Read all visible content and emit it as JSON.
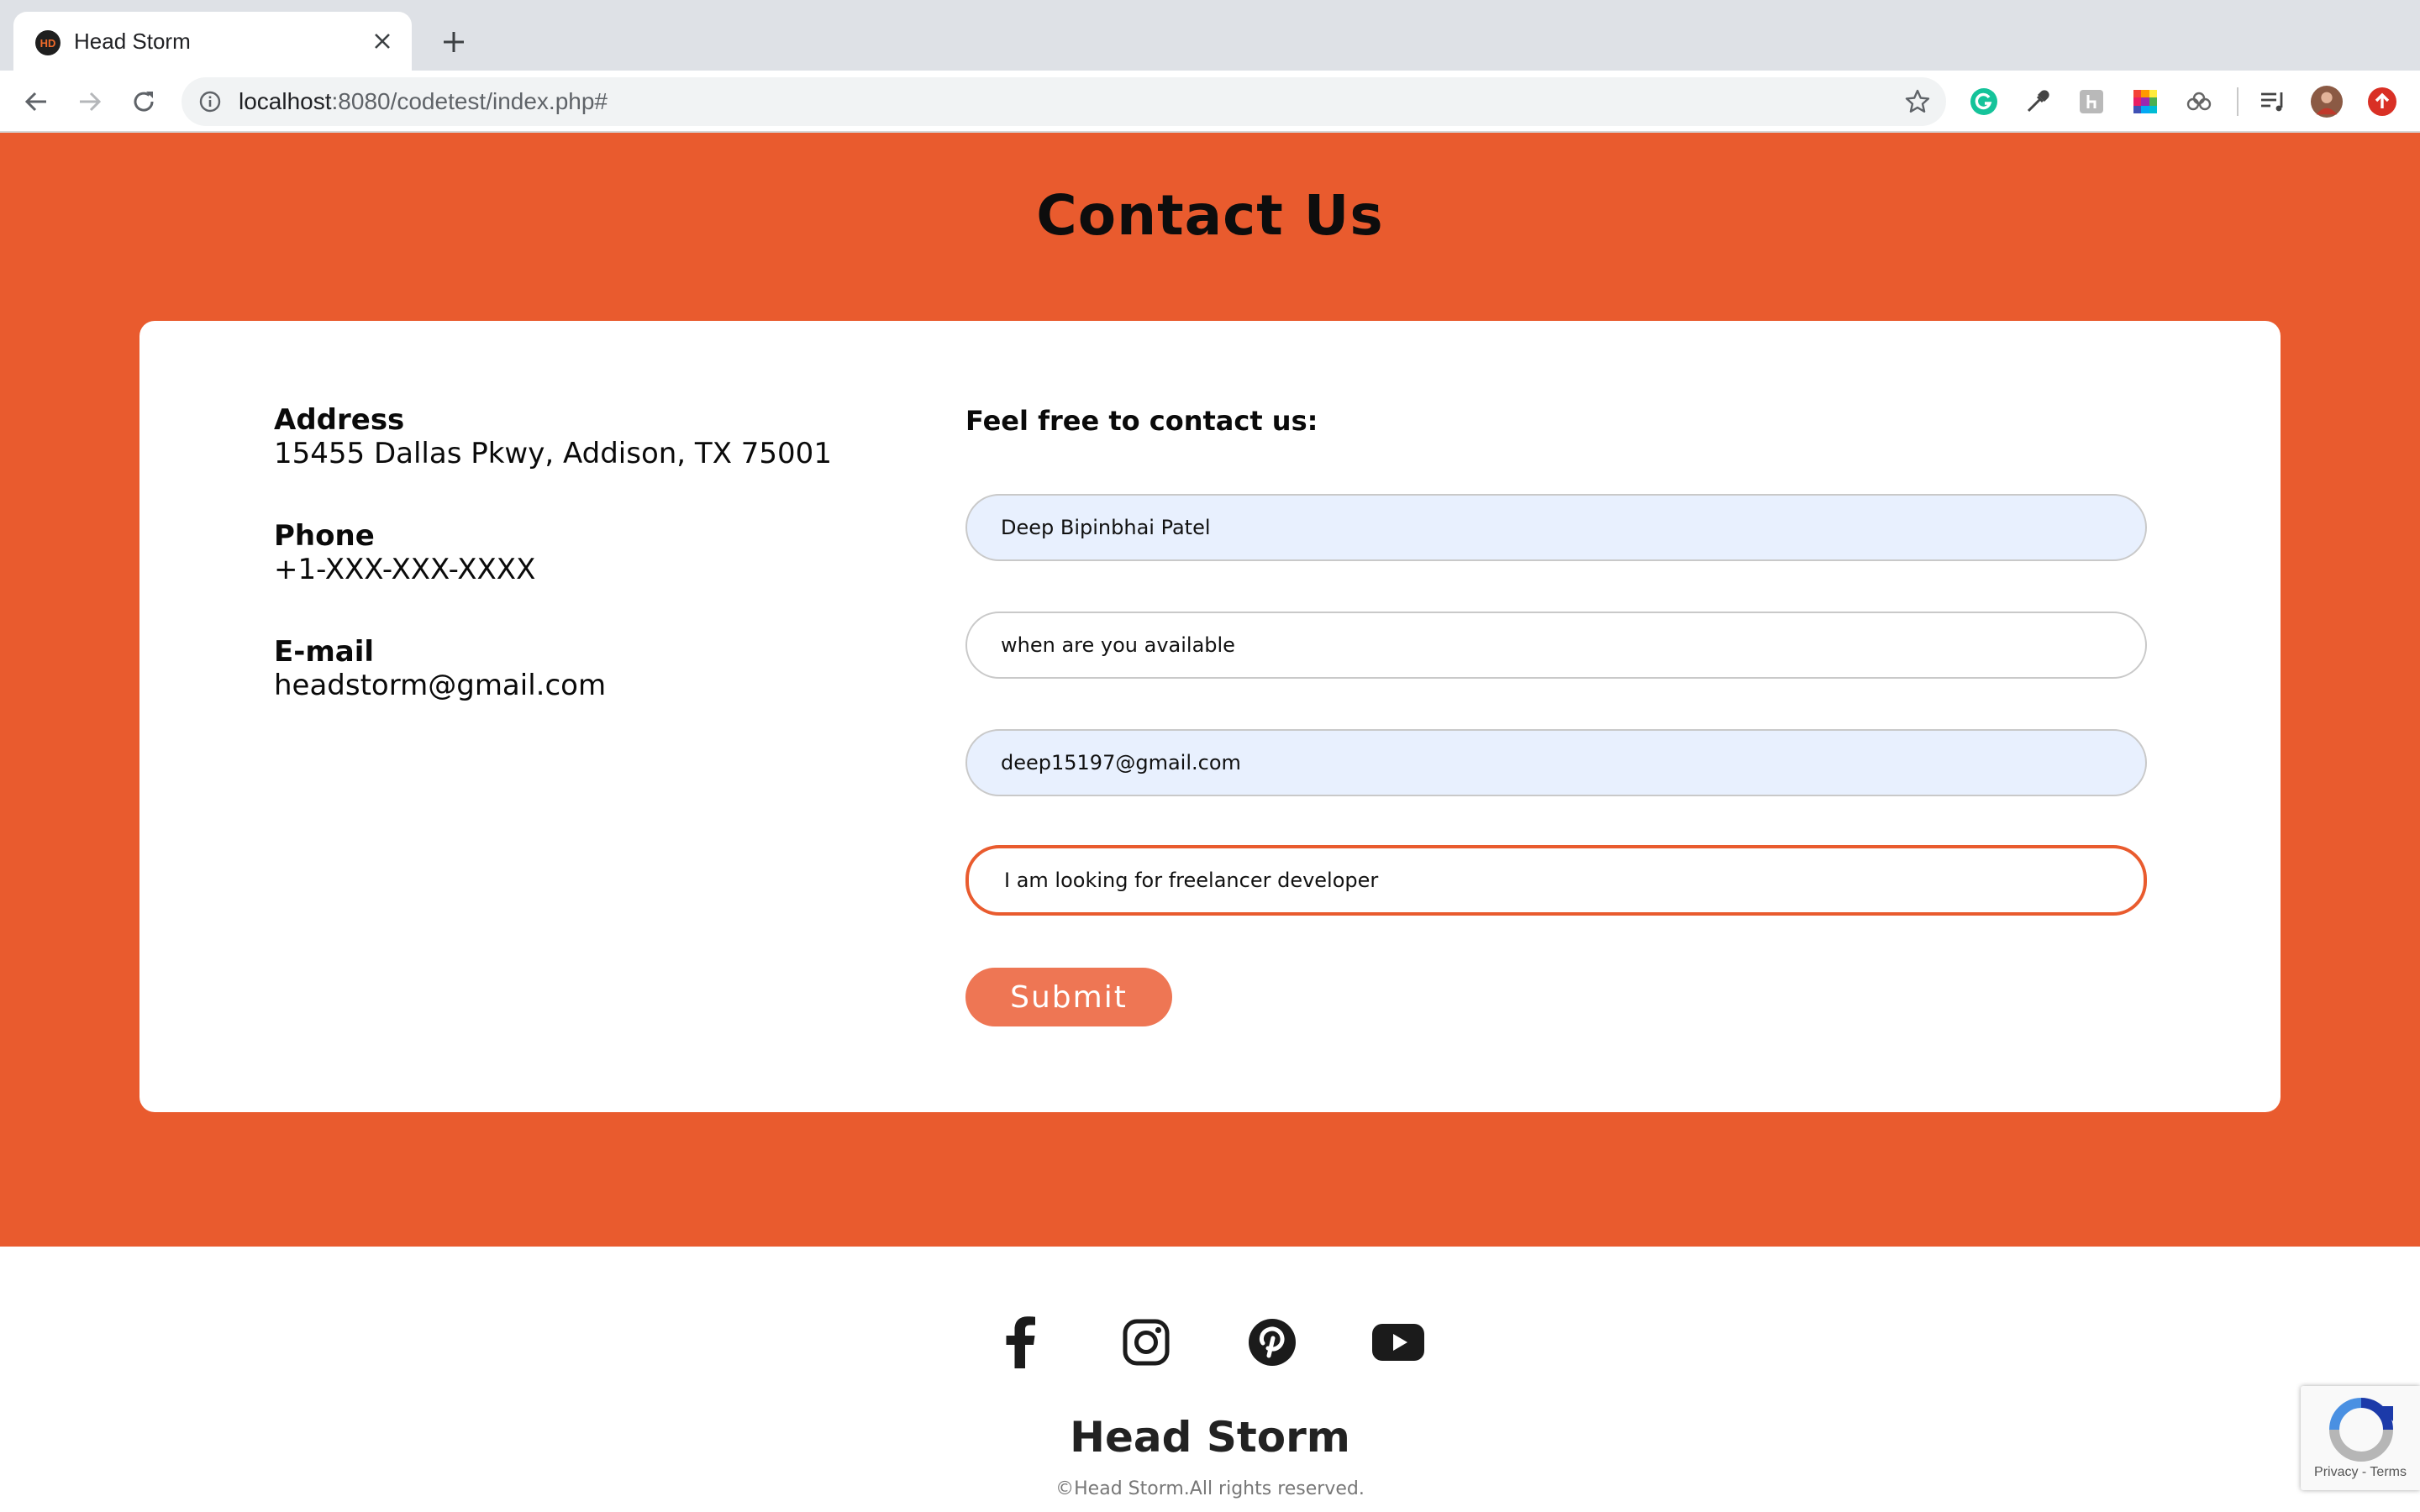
{
  "browser": {
    "tab_title": "Head Storm",
    "favicon_text": "HD",
    "url_host": "localhost",
    "url_rest": ":8080/codetest/index.php#"
  },
  "page": {
    "title": "Contact Us",
    "accent_color": "#e95b2e",
    "info": {
      "address_label": "Address",
      "address_value": "15455 Dallas Pkwy, Addison, TX 75001",
      "phone_label": "Phone",
      "phone_value": "+1-XXX-XXX-XXXX",
      "email_label": "E-mail",
      "email_value": "headstorm@gmail.com"
    },
    "form": {
      "heading": "Feel free to contact us:",
      "name_value": "Deep Bipinbhai Patel",
      "subject_value": "when are you available",
      "email_value": "deep15197@gmail.com",
      "message_value": "I am looking for freelancer developer",
      "submit_label": "Submit"
    }
  },
  "footer": {
    "social_icons": [
      "facebook-icon",
      "instagram-icon",
      "pinterest-icon",
      "youtube-icon"
    ],
    "brand": "Head Storm",
    "copyright": "©Head Storm.All rights reserved."
  },
  "recaptcha": {
    "links": "Privacy - Terms"
  }
}
